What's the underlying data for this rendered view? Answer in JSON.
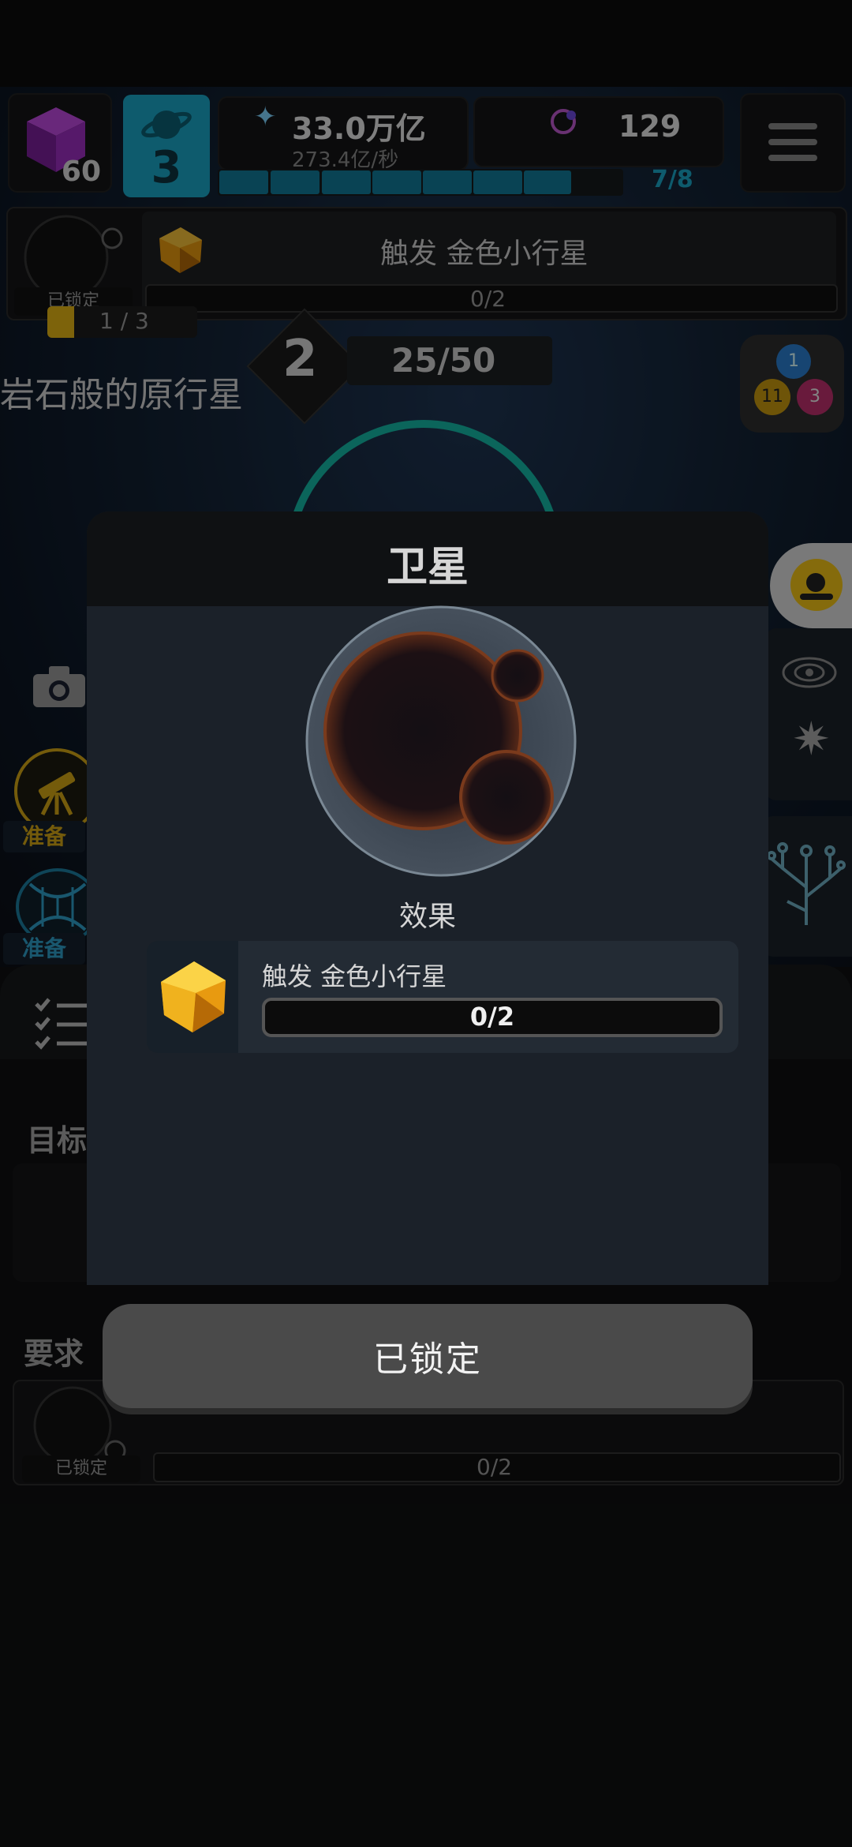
{
  "header": {
    "cube_level": "60",
    "planet_level": "3",
    "currency_amount": "33.0万亿",
    "currency_rate": "273.4亿/秒",
    "gem_count": "129",
    "progress_text": "7/8",
    "progress": 0.875
  },
  "locked_slot": {
    "status": "已锁定",
    "title": "触发 金色小行星",
    "count": "0/2",
    "progress_partial": "1 / 3"
  },
  "level": {
    "number": "2",
    "progress": "25/50",
    "name": "岩石般的原行星"
  },
  "badges": [
    "1",
    "11",
    "3"
  ],
  "side": {
    "telescope_label": "准备",
    "wormhole_label": "准备",
    "goal_label": "目标",
    "require_label": "要求"
  },
  "bottom_slot": {
    "status": "已锁定",
    "count": "0/2"
  },
  "modal": {
    "title": "卫星",
    "effect_heading": "效果",
    "effect_title": "触发 金色小行星",
    "effect_count": "0/2",
    "effect_progress": 0.0,
    "button_label": "已锁定"
  },
  "colors": {
    "accent_cyan": "#1aa6c7",
    "gold": "#f2b21b",
    "modal_bg": "#1b2129",
    "button_bg": "#4a4a4a"
  }
}
